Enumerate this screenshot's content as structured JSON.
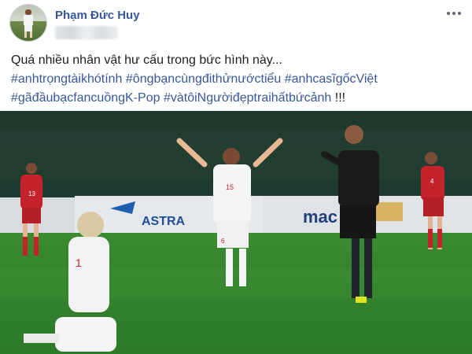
{
  "post": {
    "author": "Phạm Đức Huy",
    "text_line1": "Quá nhiều nhân vật hư cấu trong bức hình này...",
    "hashtags": [
      "#anhtrọngtàikhótính",
      "#ôngbạncùngđithửnướctiểu",
      "#anhcasĩgốcViệt",
      "#gãđầubạcfancuồngK-Pop",
      "#vàtôiNgườiđẹptraihấtbứcảnh"
    ],
    "ending": "!!!"
  },
  "photo": {
    "banner_astra": "ASTRA",
    "banner_mac": "mac",
    "jersey_left_player": "13",
    "jersey_center_player": "15",
    "jersey_shorts_center": "6",
    "jersey_kneeling": "1",
    "jersey_right_player": "4"
  },
  "colors": {
    "link": "#385898",
    "text": "#1c1e21",
    "grass": "#2f7f2a",
    "red_kit": "#c4232b",
    "white_kit": "#f4f4f4",
    "referee": "#1b1b1b"
  }
}
